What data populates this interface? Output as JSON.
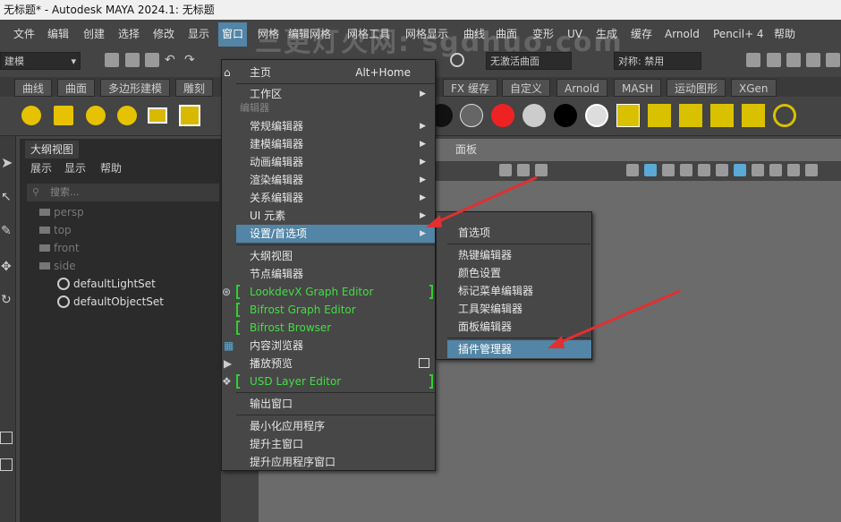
{
  "title": "无标题* - Autodesk MAYA 2024.1: 无标题",
  "menubar": [
    "文件",
    "编辑",
    "创建",
    "选择",
    "修改",
    "显示",
    "窗口",
    "网格",
    "编辑网格",
    "网格工具",
    "网格显示",
    "曲线",
    "曲面",
    "变形",
    "UV",
    "生成",
    "缓存",
    "Arnold",
    "Pencil+ 4",
    "帮助"
  ],
  "statusline": {
    "mode": "建模",
    "curve_field": "无激活曲面",
    "symmetry": "对称: 禁用"
  },
  "shelf_tabs": [
    "曲线",
    "曲面",
    "多边形建模",
    "雕刻",
    "FX 缓存",
    "自定义",
    "Arnold",
    "MASH",
    "运动图形",
    "XGen"
  ],
  "outliner": {
    "tab": "大纲视图",
    "menu": [
      "展示",
      "显示",
      "帮助"
    ],
    "search_placeholder": "搜索...",
    "items": [
      "persp",
      "top",
      "front",
      "side",
      "defaultLightSet",
      "defaultObjectSet"
    ]
  },
  "viewport_menu": "面板",
  "window_menu": {
    "home": "主页",
    "home_shortcut": "Alt+Home",
    "workspace": "工作区",
    "section_editors": "编辑器",
    "general_editors": "常规编辑器",
    "modeling_editors": "建模编辑器",
    "animation_editors": "动画编辑器",
    "rendering_editors": "渲染编辑器",
    "relationship_editors": "关系编辑器",
    "ui_elements": "UI 元素",
    "settings_prefs": "设置/首选项",
    "outliner": "大纲视图",
    "node_editor": "节点编辑器",
    "lookdevx": "LookdevX Graph Editor",
    "bifrost_graph": "Bifrost Graph Editor",
    "bifrost_browser": "Bifrost Browser",
    "content_browser": "内容浏览器",
    "playblast": "播放预览",
    "usd_layer": "USD Layer Editor",
    "output_window": "输出窗口",
    "minimize_app": "最小化应用程序",
    "raise_main": "提升主窗口",
    "raise_app": "提升应用程序窗口"
  },
  "submenu": [
    "首选项",
    "热键编辑器",
    "颜色设置",
    "标记菜单编辑器",
    "工具架编辑器",
    "面板编辑器",
    "插件管理器"
  ],
  "watermark": "三更灯火网: sgdhuo.com",
  "colors": {
    "highlight": "#5285a6",
    "green_item": "#44dd44",
    "arrow": "#e03030"
  }
}
